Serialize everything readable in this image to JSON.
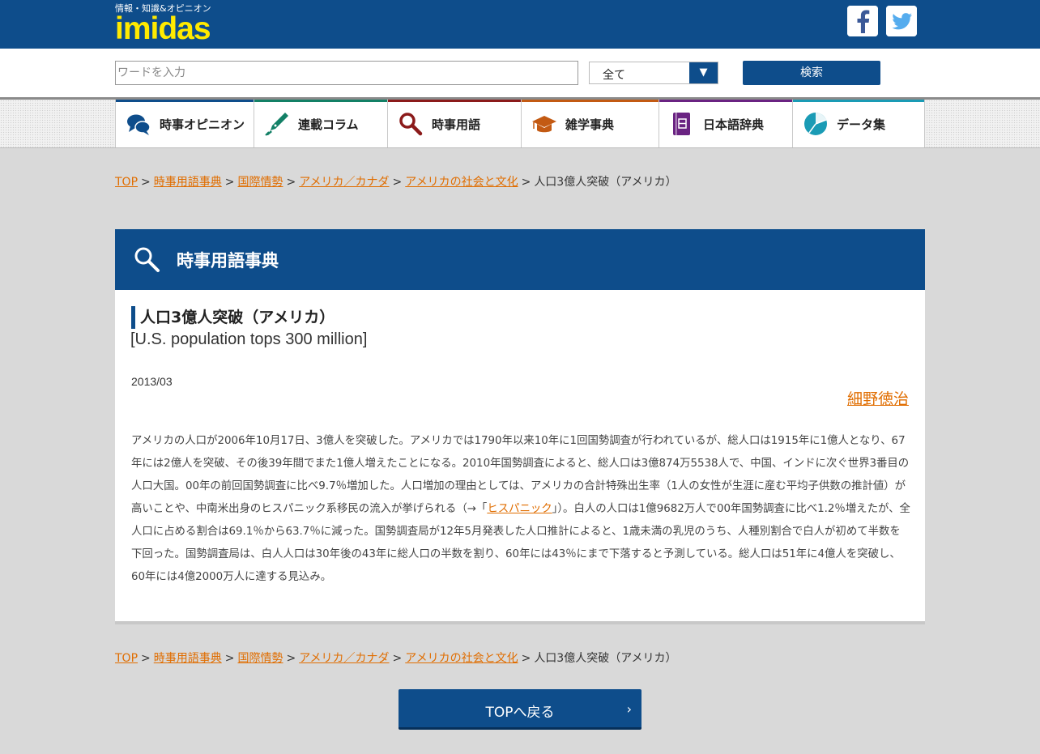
{
  "header": {
    "tagline": "情報・知識&オピニオン",
    "logo": "imidas",
    "facebook_icon": "facebook-icon",
    "twitter_icon": "twitter-icon"
  },
  "search": {
    "placeholder": "ワードを入力",
    "category": "全て",
    "dropdown_arrow": "▼",
    "button": "検索"
  },
  "nav": {
    "items": [
      {
        "label": "時事オピニオン",
        "color": "#0e4d8b",
        "icon": "speech-bubbles-icon"
      },
      {
        "label": "連載コラム",
        "color": "#138066",
        "icon": "pen-icon"
      },
      {
        "label": "時事用語",
        "color": "#8b1a1a",
        "icon": "magnifier-icon"
      },
      {
        "label": "雑学事典",
        "color": "#c35a13",
        "icon": "mortarboard-icon"
      },
      {
        "label": "日本語辞典",
        "color": "#6a2382",
        "icon": "dictionary-icon"
      },
      {
        "label": "データ集",
        "color": "#1a9bb5",
        "icon": "pie-chart-icon"
      }
    ]
  },
  "breadcrumb": {
    "items": [
      "TOP",
      "時事用語事典",
      "国際情勢",
      "アメリカ／カナダ",
      "アメリカの社会と文化"
    ],
    "current": "人口3億人突破（アメリカ）",
    "separator": ">"
  },
  "section": {
    "title": "時事用語事典",
    "icon": "magnifier-icon"
  },
  "article": {
    "title": "人口3億人突破（アメリカ）",
    "title_en": "[U.S. population tops 300 million]",
    "date": "2013/03",
    "author": "細野徳治",
    "body_before": "アメリカの人口が2006年10月17日、3億人を突破した。アメリカでは1790年以来10年に1回国勢調査が行われているが、総人口は1915年に1億人となり、67年には2億人を突破、その後39年間でまた1億人増えたことになる。2010年国勢調査によると、総人口は3億874万5538人で、中国、インドに次ぐ世界3番目の人口大国。00年の前回国勢調査に比べ9.7％増加した。人口増加の理由としては、アメリカの合計特殊出生率（1人の女性が生涯に産む平均子供数の推計値）が高いことや、中南米出身のヒスパニック系移民の流入が挙げられる（→「",
    "link": "ヒスパニック",
    "body_after": "」）。白人の人口は1億9682万人で00年国勢調査に比べ1.2％増えたが、全人口に占める割合は69.1％から63.7％に減った。国勢調査局が12年5月発表した人口推計によると、1歳未満の乳児のうち、人種別割合で白人が初めて半数を下回った。国勢調査局は、白人人口は30年後の43年に総人口の半数を割り、60年には43％にまで下落すると予測している。総人口は51年に4億人を突破し、60年には4億2000万人に達する見込み。"
  },
  "footer": {
    "back_button": "TOPへ戻る",
    "back_chevron": "›"
  }
}
